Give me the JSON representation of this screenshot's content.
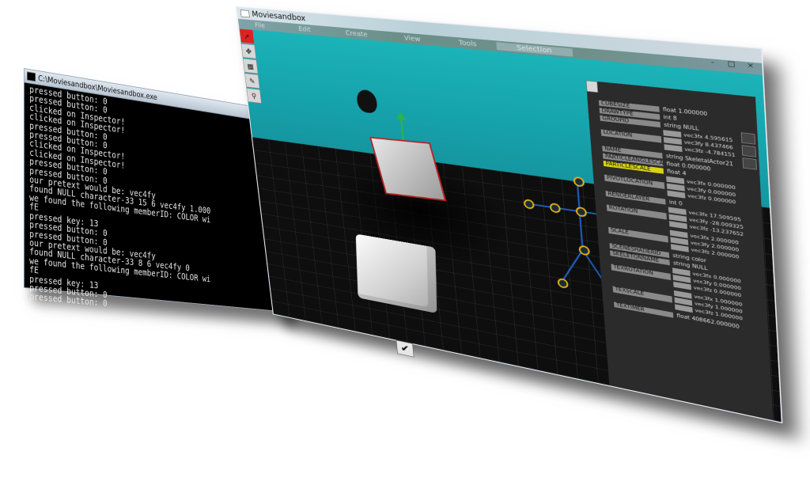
{
  "console": {
    "title": "C:\\Moviesandbox\\Moviesandbox.exe",
    "lines": [
      "pressed button: 0",
      "pressed button: 0",
      "clicked on Inspector!",
      "clicked on Inspector!",
      "pressed button: 0",
      "pressed button: 0",
      "clicked on Inspector!",
      "clicked on Inspector!",
      "pressed button: 0",
      "pressed button: 0",
      "our pretext would be: vec4fy",
      "found NULL character-33 15 6 vec4fy 1.000",
      "we found the following memberID: COLOR wi",
      "fE",
      "pressed key: 13",
      "pressed button: 0",
      "pressed button: 0",
      "our pretext would be: vec4fy",
      "found NULL character-33 8 6 vec4fy 0",
      "we found the following memberID: COLOR wi",
      "fE",
      "pressed key: 13",
      "pressed button: 0",
      "pressed button: 0"
    ]
  },
  "app": {
    "title": "Moviesandbox",
    "menu": [
      "File",
      "Edit",
      "Create",
      "View",
      "Tools",
      "Selection"
    ],
    "window_controls": [
      "-",
      "□",
      "×"
    ]
  },
  "inspector": {
    "props_top": [
      {
        "name": "CUBESIZE",
        "value": "float 1.000000"
      },
      {
        "name": "DRAWTYPE",
        "value": "int 8"
      },
      {
        "name": "GROUPID",
        "value": "string NULL"
      }
    ],
    "location": {
      "name": "LOCATION",
      "values": [
        "vec3fx 4.595615",
        "vec3fy 8.437466",
        "vec3fz -4.784151"
      ]
    },
    "props_mid": [
      {
        "name": "NAME",
        "value": "string SkeletalActor21"
      },
      {
        "name": "PARTICLEANGLESCALE",
        "value": "float 0.000000"
      },
      {
        "name": "PARTICLESCALE",
        "value": "float 4",
        "highlight": true
      }
    ],
    "pivot": {
      "name": "PIVOTLOCATION",
      "values": [
        "vec3fx 0.000000",
        "vec3fy 0.000000",
        "vec3fz 0.000000"
      ]
    },
    "renderlayer": {
      "name": "RENDERLAYER",
      "value": "int 0"
    },
    "rotation": {
      "name": "ROTATION",
      "values": [
        "vec3fx 17.509595",
        "vec3fy -28.009325",
        "vec3fz -13.237652"
      ]
    },
    "scale": {
      "name": "SCALE",
      "values": [
        "vec3fx 2.000000",
        "vec3fy 2.000000",
        "vec3fz 2.000000"
      ]
    },
    "props_low": [
      {
        "name": "SCENESHADERID",
        "value": "string color"
      },
      {
        "name": "SKELETONNAME",
        "value": "string NULL"
      }
    ],
    "texrotation": {
      "name": "TEXROTATION",
      "values": [
        "vec3fx 0.000000",
        "vec3fy 0.000000",
        "vec3fz 0.000000"
      ]
    },
    "texscale": {
      "name": "TEXSCALE",
      "values": [
        "vec3fx 1.000000",
        "vec3fy 1.000000",
        "vec3fz 1.000000"
      ]
    },
    "textimer": {
      "name": "TEXTIMER",
      "value": "float 408662.000000"
    }
  }
}
